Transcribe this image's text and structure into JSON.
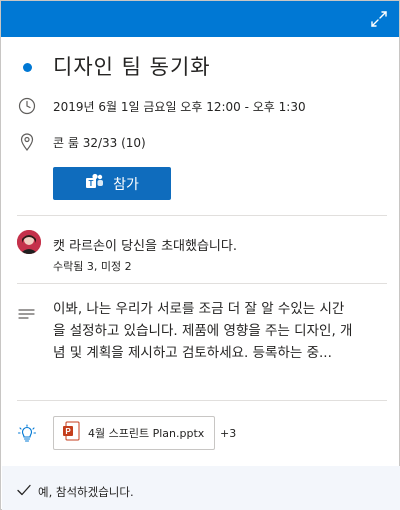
{
  "header": {
    "accent_color": "#0078d4",
    "expand_icon": "expand-icon"
  },
  "event": {
    "title": "디자인 팀 동기화",
    "datetime": "2019년 6월 1일 금요일 오후 12:00 - 오후 1:30",
    "location": "콘 룸 32/33 (10)",
    "join_label": "참가"
  },
  "organizer": {
    "invite_text": "캣 라르손이 당신을 초대했습니다.",
    "response_summary": "수락됨 3, 미정 2"
  },
  "description": {
    "text": "이봐, 나는 우리가 서로를 조금 더 잘 알 수있는 시간을 설정하고 있습니다. 제품에 영향을 주는 디자인, 개념 및 계획을 제시하고 검토하세요. 등록하는 중..."
  },
  "attachments": {
    "file_name": "4월 스프린트 Plan.pptx",
    "more_label": "+3"
  },
  "footer": {
    "rsvp_label": "예, 참석하겠습니다."
  }
}
